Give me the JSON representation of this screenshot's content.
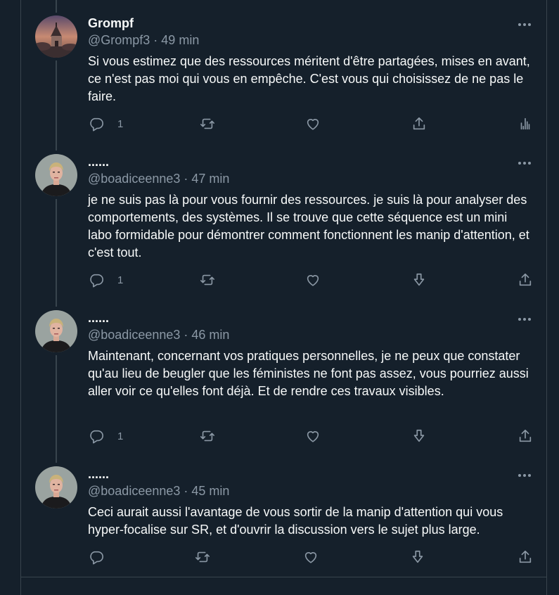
{
  "colors": {
    "background": "#15202b",
    "border": "#38444d",
    "text": "#f7f9f9",
    "muted": "#8b98a5"
  },
  "tweets": [
    {
      "name": "Grompf",
      "handle": "@Grompf3",
      "time": "49 min",
      "text": "Si vous estimez que des ressources méritent d'être partagées, mises en avant, ce n'est pas moi qui vous en empêche. C'est vous qui choisissez de ne pas le faire.",
      "reply_count": "1",
      "avatar_icon": "chapel-photo-avatar",
      "actions": [
        "reply-icon",
        "retweet-icon",
        "like-icon",
        "share-icon",
        "analytics-icon"
      ]
    },
    {
      "name": "......",
      "handle": "@boadiceenne3",
      "time": "47 min",
      "text": "je ne suis pas là pour vous fournir des ressources. je suis là pour analyser des comportements, des systèmes. Il se trouve que cette séquence est un mini labo formidable pour démontrer comment fonctionnent les manip d'attention,  et c'est tout.",
      "reply_count": "1",
      "avatar_icon": "woman-portrait-avatar",
      "actions": [
        "reply-icon",
        "retweet-icon",
        "like-icon",
        "downvote-icon",
        "share-icon"
      ]
    },
    {
      "name": "......",
      "handle": "@boadiceenne3",
      "time": "46 min",
      "text": "Maintenant, concernant vos pratiques personnelles, je ne peux que constater qu'au lieu de beugler que les féministes ne font pas assez, vous pourriez aussi aller voir ce qu'elles font déjà. Et de rendre ces travaux visibles.",
      "reply_count": "1",
      "avatar_icon": "woman-portrait-avatar",
      "actions": [
        "reply-icon",
        "retweet-icon",
        "like-icon",
        "downvote-icon",
        "share-icon"
      ]
    },
    {
      "name": "......",
      "handle": "@boadiceenne3",
      "time": "45 min",
      "text": "Ceci aurait aussi l'avantage de vous sortir de la manip d'attention qui vous hyper-focalise sur SR, et d'ouvrir la discussion vers le sujet plus large.",
      "reply_count": "",
      "avatar_icon": "woman-portrait-avatar",
      "actions": [
        "reply-icon",
        "retweet-icon",
        "like-icon",
        "downvote-icon",
        "share-icon"
      ]
    }
  ],
  "meta_separator": " · "
}
